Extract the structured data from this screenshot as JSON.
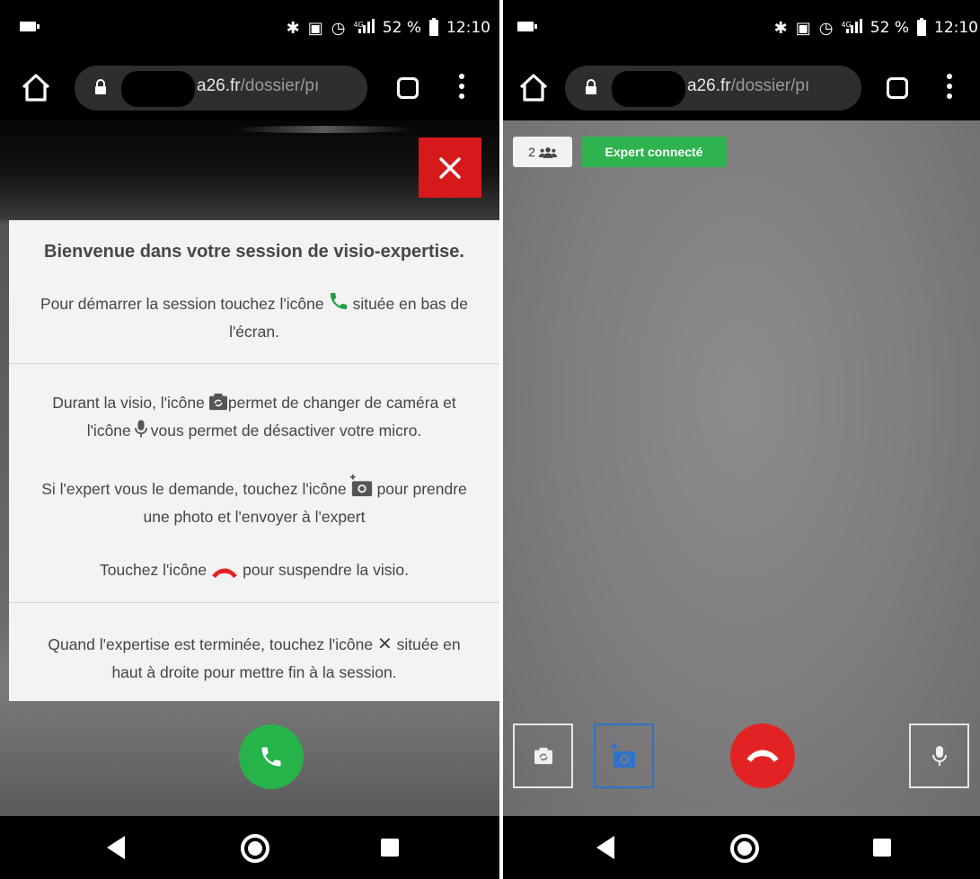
{
  "left_screen": {
    "status_bar": {
      "network": "4G",
      "battery": "52 %",
      "time": "12:10"
    },
    "browser": {
      "url_domain": "a26.fr",
      "url_path": "/dossier/pı"
    },
    "close_button_label": "✕",
    "welcome_panel": {
      "title": "Bienvenue dans votre session de visio-expertise.",
      "start_line1_before": "Pour démarrer la session touchez l'icône",
      "start_line1_after": "située en bas de",
      "start_line2": "l'écran.",
      "camera_line1_before": "Durant la visio, l'icône",
      "camera_line1_after": "permet de changer de caméra et",
      "camera_line2_before": "l'icône",
      "camera_line2_after": "vous permet de désactiver votre micro.",
      "photo_line1_before": "Si l'expert vous le demande, touchez l'icône",
      "photo_line1_after": "pour prendre",
      "photo_line2": "une photo et l'envoyer à l'expert",
      "hangup_line_before": "Touchez l'icône",
      "hangup_line_after": "pour suspendre la visio.",
      "end_line1_before": "Quand l'expertise est terminée, touchez l'icône",
      "end_line1_icon": "✕",
      "end_line1_after": "située en",
      "end_line2": "haut à droite pour mettre fin à la session."
    }
  },
  "right_screen": {
    "status_bar": {
      "network": "4G",
      "battery": "52 %",
      "time": "12:10"
    },
    "browser": {
      "url_domain": "a26.fr",
      "url_path": "/dossier/pı"
    },
    "participants_count": "2",
    "connection_status": "Expert connecté"
  },
  "colors": {
    "close_red": "#d7191b",
    "call_green": "#25b34a",
    "hangup_red": "#e32323",
    "status_green": "#2fb34f",
    "snap_blue": "#2e73c9"
  },
  "icons": [
    "home-icon",
    "lock-icon",
    "tabs-icon",
    "menu-icon",
    "close-icon",
    "phone-icon",
    "camera-switch-icon",
    "microphone-icon",
    "add-photo-icon",
    "hangup-icon",
    "users-icon",
    "back-icon",
    "home-circle-icon",
    "recent-apps-icon"
  ]
}
